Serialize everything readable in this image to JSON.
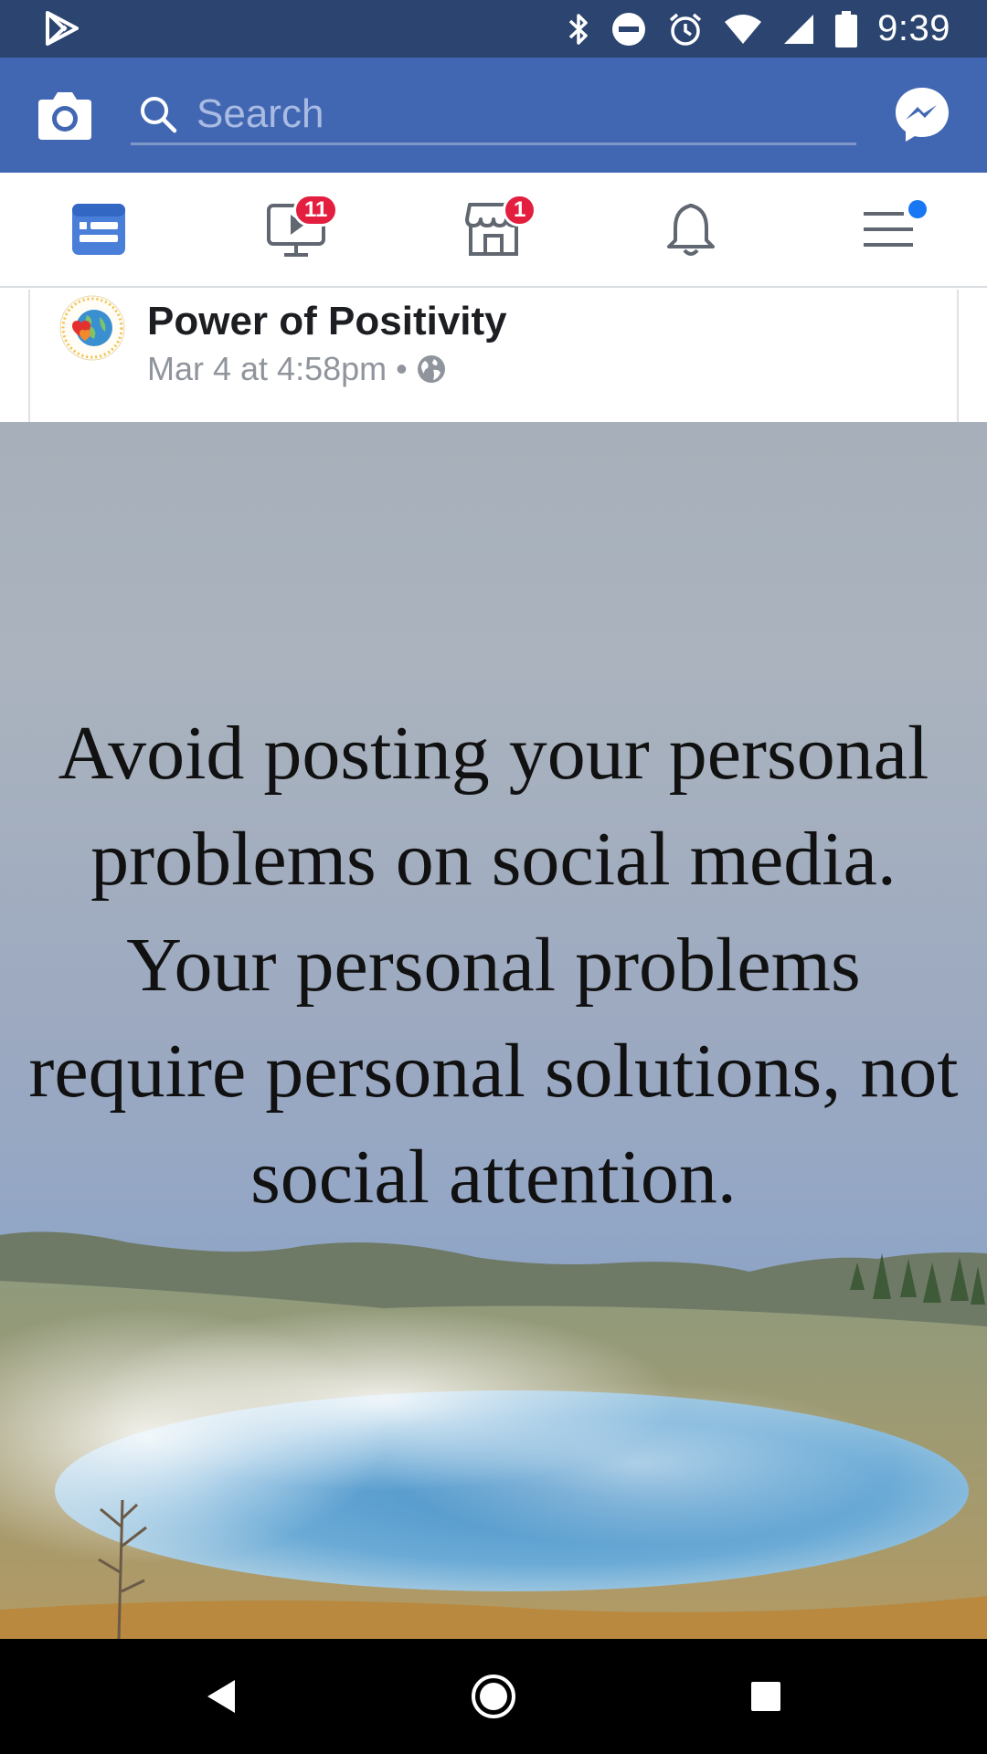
{
  "status_bar": {
    "time": "9:39",
    "icons": [
      "play-store-icon",
      "bluetooth-icon",
      "do-not-disturb-icon",
      "alarm-icon",
      "wifi-icon",
      "signal-icon",
      "battery-icon"
    ]
  },
  "app_bar": {
    "search_placeholder": "Search",
    "left_icon": "camera-icon",
    "right_icon": "messenger-icon",
    "background": "#4267b2"
  },
  "tabs": [
    {
      "name": "news-feed",
      "icon": "news-feed-icon",
      "active": true
    },
    {
      "name": "watch",
      "icon": "watch-icon",
      "badge": "11"
    },
    {
      "name": "marketplace",
      "icon": "marketplace-icon",
      "badge": "1"
    },
    {
      "name": "notifications",
      "icon": "bell-icon"
    },
    {
      "name": "menu",
      "icon": "menu-icon",
      "dot": true
    }
  ],
  "post": {
    "page_name": "Power of Positivity",
    "timestamp": "Mar 4 at 4:58pm",
    "separator": "•",
    "privacy_icon": "globe-icon",
    "image_text": "Avoid posting your personal problems on social media. Your personal problems require personal solutions, not social attention."
  },
  "nav_bar": {
    "buttons": [
      "back-icon",
      "home-icon",
      "recents-icon"
    ]
  },
  "colors": {
    "status_bar": "#2b4470",
    "brand": "#4267b2",
    "active_tab": "#4a7fd9",
    "badge": "#e41e3f"
  }
}
